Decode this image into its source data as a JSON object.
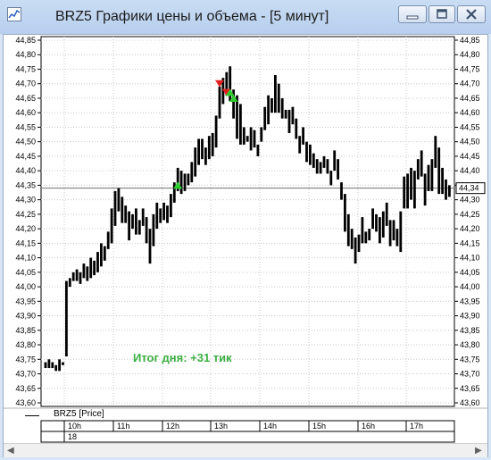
{
  "window": {
    "title": "BRZ5 Графики цены и объема - [5 минут]",
    "icon": "app-chart-icon",
    "buttons": [
      "minimize-icon",
      "maximize-icon",
      "close-icon"
    ]
  },
  "legend": {
    "label": "BRZ5 [Price]"
  },
  "time_axis": {
    "labels": [
      "10h",
      "11h",
      "12h",
      "13h",
      "14h",
      "15h",
      "16h",
      "17h"
    ],
    "day": "18"
  },
  "result_text": "Итог дня: +31 тик",
  "current_price": "44,34",
  "colors": {
    "candle": "#000000",
    "buy_marker": "#2ecc2e",
    "sell_marker": "#e02020",
    "result_text": "#3cb043"
  },
  "chart_data": {
    "type": "bar",
    "instrument": "BRZ5",
    "timeframe": "5 минут",
    "ylim": [
      43.6,
      44.85
    ],
    "y_ticks": [
      "44,85",
      "44,80",
      "44,75",
      "44,70",
      "44,65",
      "44,60",
      "44,55",
      "44,50",
      "44,45",
      "44,40",
      "44,35",
      "44,30",
      "44,25",
      "44,20",
      "44,15",
      "44,10",
      "44,05",
      "44,00",
      "43,95",
      "43,90",
      "43,85",
      "43,80",
      "43,75",
      "43,70",
      "43,65",
      "43,60"
    ],
    "x_labels": [
      "10h",
      "11h",
      "12h",
      "13h",
      "14h",
      "15h",
      "16h",
      "17h"
    ],
    "last_price": 44.34,
    "bars": [
      [
        43.74,
        43.72
      ],
      [
        43.75,
        43.72
      ],
      [
        43.74,
        43.72
      ],
      [
        43.73,
        43.71
      ],
      [
        43.75,
        43.71
      ],
      [
        43.74,
        43.73
      ],
      [
        44.02,
        43.76
      ],
      [
        44.03,
        44.0
      ],
      [
        44.05,
        44.02
      ],
      [
        44.06,
        44.02
      ],
      [
        44.05,
        44.01
      ],
      [
        44.08,
        44.03
      ],
      [
        44.07,
        44.02
      ],
      [
        44.1,
        44.03
      ],
      [
        44.09,
        44.04
      ],
      [
        44.12,
        44.05
      ],
      [
        44.15,
        44.07
      ],
      [
        44.14,
        44.09
      ],
      [
        44.19,
        44.13
      ],
      [
        44.27,
        44.15
      ],
      [
        44.33,
        44.21
      ],
      [
        44.34,
        44.26
      ],
      [
        44.31,
        44.22
      ],
      [
        44.28,
        44.22
      ],
      [
        44.26,
        44.16
      ],
      [
        44.25,
        44.2
      ],
      [
        44.27,
        44.18
      ],
      [
        44.23,
        44.18
      ],
      [
        44.27,
        44.21
      ],
      [
        44.24,
        44.15
      ],
      [
        44.2,
        44.08
      ],
      [
        44.25,
        44.14
      ],
      [
        44.29,
        44.2
      ],
      [
        44.27,
        44.22
      ],
      [
        44.29,
        44.23
      ],
      [
        44.28,
        44.22
      ],
      [
        44.32,
        44.24
      ],
      [
        44.36,
        44.29
      ],
      [
        44.41,
        44.33
      ],
      [
        44.4,
        44.32
      ],
      [
        44.39,
        44.33
      ],
      [
        44.39,
        44.35
      ],
      [
        44.43,
        44.36
      ],
      [
        44.48,
        44.38
      ],
      [
        44.51,
        44.42
      ],
      [
        44.51,
        44.44
      ],
      [
        44.48,
        44.42
      ],
      [
        44.52,
        44.44
      ],
      [
        44.53,
        44.45
      ],
      [
        44.59,
        44.48
      ],
      [
        44.69,
        44.58
      ],
      [
        44.72,
        44.63
      ],
      [
        44.74,
        44.66
      ],
      [
        44.76,
        44.64
      ],
      [
        44.68,
        44.58
      ],
      [
        44.66,
        44.51
      ],
      [
        44.63,
        44.49
      ],
      [
        44.55,
        44.49
      ],
      [
        44.52,
        44.5
      ],
      [
        44.55,
        44.47
      ],
      [
        44.54,
        44.48
      ],
      [
        44.49,
        44.45
      ],
      [
        44.55,
        44.5
      ],
      [
        44.62,
        44.54
      ],
      [
        44.66,
        44.56
      ],
      [
        44.65,
        44.6
      ],
      [
        44.73,
        44.6
      ],
      [
        44.7,
        44.6
      ],
      [
        44.65,
        44.58
      ],
      [
        44.61,
        44.58
      ],
      [
        44.61,
        44.53
      ],
      [
        44.62,
        44.56
      ],
      [
        44.58,
        44.51
      ],
      [
        44.52,
        44.46
      ],
      [
        44.55,
        44.49
      ],
      [
        44.5,
        44.43
      ],
      [
        44.49,
        44.42
      ],
      [
        44.46,
        44.41
      ],
      [
        44.44,
        44.39
      ],
      [
        44.43,
        44.39
      ],
      [
        44.45,
        44.41
      ],
      [
        44.44,
        44.39
      ],
      [
        44.4,
        44.35
      ],
      [
        44.47,
        44.4
      ],
      [
        44.44,
        44.37
      ],
      [
        44.36,
        44.3
      ],
      [
        44.32,
        44.19
      ],
      [
        44.25,
        44.14
      ],
      [
        44.2,
        44.13
      ],
      [
        44.17,
        44.08
      ],
      [
        44.18,
        44.12
      ],
      [
        44.24,
        44.15
      ],
      [
        44.19,
        44.15
      ],
      [
        44.2,
        44.16
      ],
      [
        44.27,
        44.2
      ],
      [
        44.25,
        44.19
      ],
      [
        44.24,
        44.15
      ],
      [
        44.26,
        44.17
      ],
      [
        44.29,
        44.21
      ],
      [
        44.23,
        44.14
      ],
      [
        44.23,
        44.16
      ],
      [
        44.2,
        44.14
      ],
      [
        44.26,
        44.12
      ],
      [
        44.38,
        44.27
      ],
      [
        44.39,
        44.27
      ],
      [
        44.41,
        44.3
      ],
      [
        44.4,
        44.27
      ],
      [
        44.44,
        44.37
      ],
      [
        44.47,
        44.38
      ],
      [
        44.39,
        44.28
      ],
      [
        44.42,
        44.33
      ],
      [
        44.44,
        44.33
      ],
      [
        44.52,
        44.41
      ],
      [
        44.48,
        44.32
      ],
      [
        44.41,
        44.32
      ],
      [
        44.37,
        44.3
      ],
      [
        44.35,
        44.31
      ]
    ],
    "markers": [
      {
        "kind": "buy",
        "x_bar": 38,
        "y": 44.35
      },
      {
        "kind": "sell",
        "x_bar": 50,
        "y": 44.7
      },
      {
        "kind": "sell",
        "x_bar": 52,
        "y": 44.67
      },
      {
        "kind": "buy",
        "x_bar": 53,
        "y": 44.67
      },
      {
        "kind": "buy",
        "x_bar": 54,
        "y": 44.65
      }
    ]
  }
}
